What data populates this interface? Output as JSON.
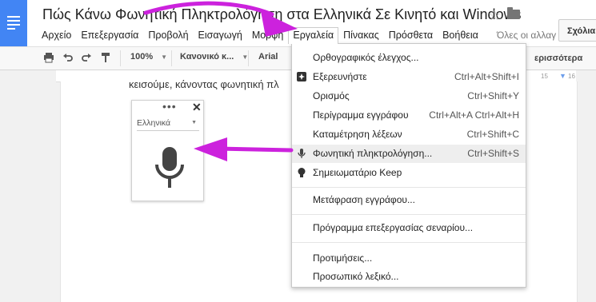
{
  "doc": {
    "title": "Πώς Κάνω Φωνητική Πληκτρολόγηση στα Ελληνικά Σε Κινητό και Windows",
    "last_edit": "Όλες οι αλλαγ",
    "comments_label": "Σχόλια",
    "body_text": "κεισούμε, κάνοντας φωνητική πλ",
    "right_text": "ερισσότερα"
  },
  "menubar": {
    "items": [
      "Αρχείο",
      "Επεξεργασία",
      "Προβολή",
      "Εισαγωγή",
      "Μορφή",
      "Εργαλεία",
      "Πίνακας",
      "Πρόσθετα",
      "Βοήθεια"
    ],
    "open_item": "Εργαλεία"
  },
  "toolbar": {
    "zoom": "100%",
    "style": "Κανονικό κ...",
    "font": "Arial"
  },
  "ruler": {
    "ticks": [
      "15",
      "16"
    ]
  },
  "voice_widget": {
    "language": "Ελληνικά",
    "more_icon": "more-dots-icon",
    "close_icon": "close-icon",
    "mic_icon": "mic-icon"
  },
  "tools_menu": {
    "items": [
      {
        "label": "Ορθογραφικός έλεγχος...",
        "shortcut": ""
      },
      {
        "label": "Εξερευνήστε",
        "shortcut": "Ctrl+Alt+Shift+I",
        "icon": "explore-icon"
      },
      {
        "label": "Ορισμός",
        "shortcut": "Ctrl+Shift+Y"
      },
      {
        "label": "Περίγραμμα εγγράφου",
        "shortcut": "Ctrl+Alt+A Ctrl+Alt+H"
      },
      {
        "label": "Καταμέτρηση λέξεων",
        "shortcut": "Ctrl+Shift+C"
      },
      {
        "label": "Φωνητική πληκτρολόγηση...",
        "shortcut": "Ctrl+Shift+S",
        "icon": "mic-icon",
        "highlighted": true
      },
      {
        "label": "Σημειωματάριο Keep",
        "shortcut": "",
        "icon": "bulb-icon"
      },
      {
        "label": "Μετάφραση εγγράφου...",
        "shortcut": ""
      },
      {
        "label": "Πρόγραμμα επεξεργασίας σεναρίου...",
        "shortcut": ""
      },
      {
        "label": "Προτιμήσεις...",
        "shortcut": ""
      },
      {
        "label": "Προσωπικό λεξικό...",
        "shortcut": ""
      }
    ]
  },
  "colors": {
    "docs_blue": "#4285f4",
    "annotation_arrow": "#cc22dd",
    "highlight": "#eeeeee"
  }
}
